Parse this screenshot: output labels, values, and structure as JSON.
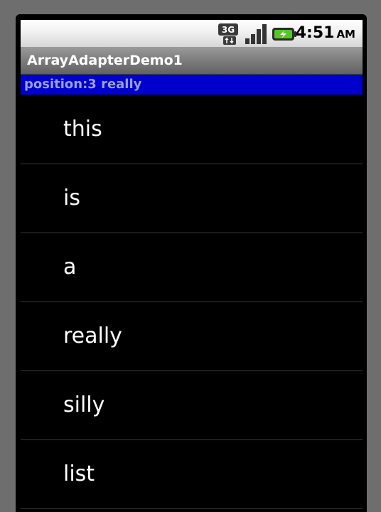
{
  "status_bar": {
    "network_label": "3G",
    "time": "4:51",
    "ampm": "AM",
    "icons": [
      "network-3g-icon",
      "signal-strength-icon",
      "battery-charging-icon"
    ],
    "colors": {
      "battery_green": "#55c820"
    }
  },
  "app": {
    "title": "ArrayAdapterDemo1"
  },
  "selection": {
    "text": "position:3  really",
    "background": "#0000cc"
  },
  "list": {
    "items": [
      {
        "label": "this"
      },
      {
        "label": "is"
      },
      {
        "label": "a"
      },
      {
        "label": "really"
      },
      {
        "label": "silly"
      },
      {
        "label": "list"
      }
    ]
  }
}
